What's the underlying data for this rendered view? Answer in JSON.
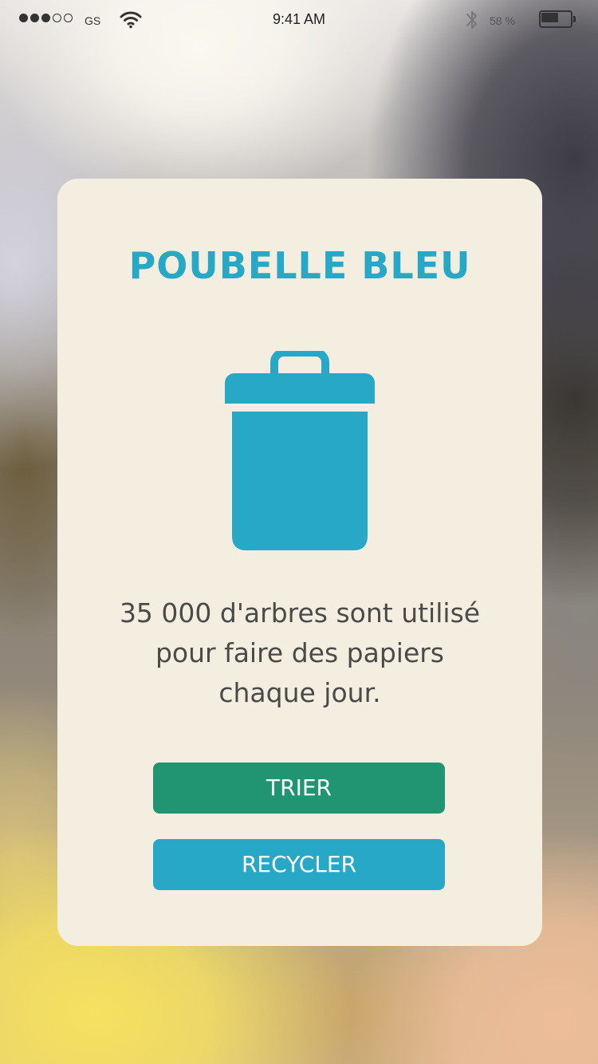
{
  "status_bar": {
    "carrier": "GS",
    "time": "9:41 AM",
    "battery_percent_label": "58 %",
    "signal_strength": 3,
    "signal_max": 5,
    "battery_level": 0.58,
    "icons": [
      "signal-dots-icon",
      "wifi-icon",
      "bluetooth-icon",
      "battery-icon"
    ]
  },
  "card": {
    "title": "POUBELLE BLEU",
    "icon": "trash-bin-icon",
    "message_lines": [
      "35 000 d'arbres sont utilisé",
      "pour faire des papiers",
      "chaque jour."
    ],
    "buttons": {
      "sort_label": "TRIER",
      "recycle_label": "RECYCLER"
    }
  },
  "colors": {
    "accent_blue": "#26a8c6",
    "accent_green": "#219571",
    "card_background": "#f4eee0",
    "text": "#4a4a4a"
  }
}
